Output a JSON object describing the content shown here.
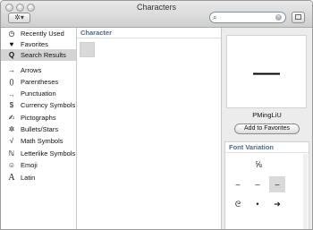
{
  "window": {
    "title": "Characters"
  },
  "toolbar": {
    "gear_label": "✲▾",
    "search": {
      "placeholder": "",
      "value": ""
    }
  },
  "sidebar": {
    "items": [
      {
        "icon": "◷",
        "icon_name": "clock-icon",
        "label": "Recently Used"
      },
      {
        "icon": "♥",
        "icon_name": "heart-icon",
        "label": "Favorites"
      },
      {
        "icon": "🔍︎",
        "icon_name": "magnifier-icon",
        "label": "Search Results",
        "selected": true
      },
      {
        "icon": "→",
        "icon_name": "arrow-icon",
        "label": "Arrows"
      },
      {
        "icon": "()",
        "icon_name": "parentheses-icon",
        "label": "Parentheses"
      },
      {
        "icon": ".,",
        "icon_name": "punctuation-icon",
        "label": "Punctuation"
      },
      {
        "icon": "$",
        "icon_name": "dollar-icon",
        "label": "Currency Symbols"
      },
      {
        "icon": "✍",
        "icon_name": "pictograph-icon",
        "label": "Pictographs"
      },
      {
        "icon": "✲",
        "icon_name": "asterisk-icon",
        "label": "Bullets/Stars"
      },
      {
        "icon": "√",
        "icon_name": "sqrt-icon",
        "label": "Math Symbols"
      },
      {
        "icon": "ℕ",
        "icon_name": "letterlike-icon",
        "label": "Letterlike Symbols"
      },
      {
        "icon": "☺",
        "icon_name": "smiley-icon",
        "label": "Emoji"
      },
      {
        "icon": "A",
        "icon_name": "latin-a-icon",
        "label": "Latin"
      }
    ]
  },
  "character_panel": {
    "header": "Character"
  },
  "inspector": {
    "preview_glyph": "—",
    "font_name": "PMingLiU",
    "add_favorites_label": "Add to Favorites",
    "font_variation": {
      "header": "Font Variation",
      "glyphs": [
        "⅝",
        "–",
        "–",
        "–",
        "ᘓ",
        "•",
        "➔"
      ]
    }
  }
}
